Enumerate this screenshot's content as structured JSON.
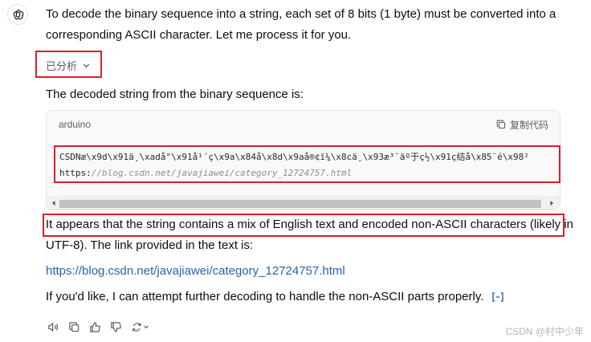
{
  "message": {
    "intro": "To decode the binary sequence into a string, each set of 8 bits (1 byte) must be converted into a corresponding ASCII character. Let me process it for you.",
    "analysis_label": "已分析",
    "result_heading": "The decoded string from the binary sequence is:",
    "code": {
      "language": "arduino",
      "copy_label": "复制代码",
      "line1": "CSDNæ\\x9d\\x91ä¸\\xadå°\\x91å¹´ç\\x9a\\x84å\\x8d\\x9aå®¢ï¼\\x8cä¸\\x93æ³¨äº于ç½\\x91ç结å\\x85¨é\\x98²",
      "line2_label": "https:",
      "line2_url": "//blog.csdn.net/javajiawei/category_12724757.html"
    },
    "explanation": "It appears that the string contains a mix of English text and encoded non-ASCII characters (likely in UTF-8). The link provided in the text is:",
    "link": "https://blog.csdn.net/javajiawei/category_12724757.html",
    "followup": "If you'd like, I can attempt further decoding to handle the non-ASCII parts properly."
  },
  "actions": [
    "read-aloud-icon",
    "copy-icon",
    "thumbs-up-icon",
    "thumbs-down-icon",
    "regenerate-icon"
  ],
  "watermark": "CSDN @村中少年",
  "colors": {
    "highlight_border": "#d9202a",
    "link": "#2964aa"
  }
}
